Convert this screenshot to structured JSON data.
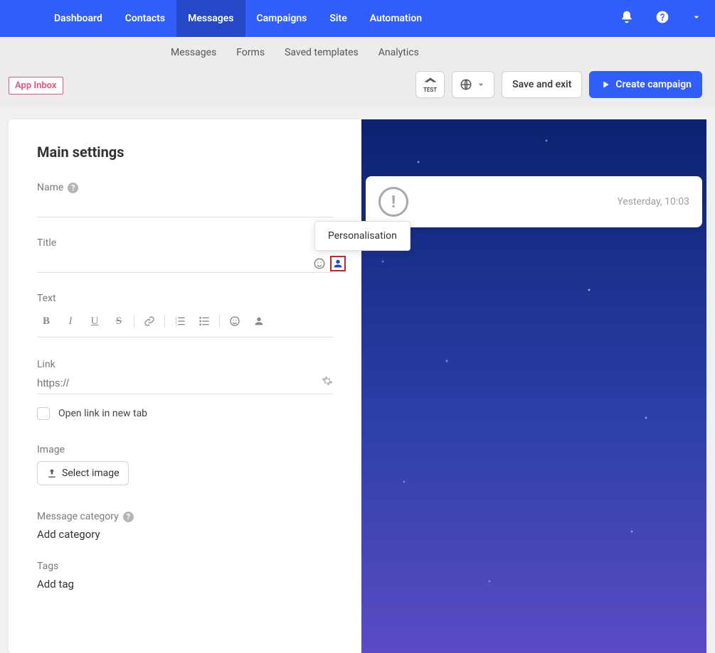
{
  "nav": {
    "items": [
      "Dashboard",
      "Contacts",
      "Messages",
      "Campaigns",
      "Site",
      "Automation"
    ],
    "active_index": 2
  },
  "subnav": {
    "tabs": [
      "Messages",
      "Forms",
      "Saved templates",
      "Analytics"
    ]
  },
  "badge": "App Inbox",
  "actions": {
    "test": "TEST",
    "save_exit": "Save and exit",
    "create_campaign": "Create campaign"
  },
  "panel": {
    "heading": "Main settings",
    "name_label": "Name",
    "name_value": "",
    "title_label": "Title",
    "title_value": "",
    "text_label": "Text",
    "link_label": "Link",
    "link_placeholder": "https://",
    "open_new_tab_label": "Open link in new tab",
    "image_label": "Image",
    "select_image_label": "Select image",
    "message_category_label": "Message category",
    "add_category_label": "Add category",
    "tags_label": "Tags",
    "add_tag_label": "Add tag"
  },
  "tooltip": {
    "personalisation": "Personalisation"
  },
  "preview": {
    "timestamp": "Yesterday, 10:03"
  },
  "toolbar": {
    "bold": "B",
    "italic": "I",
    "underline": "U",
    "strike": "S"
  },
  "colors": {
    "primary": "#315EFB",
    "badge": "#E7537A",
    "highlight": "#C62828"
  }
}
